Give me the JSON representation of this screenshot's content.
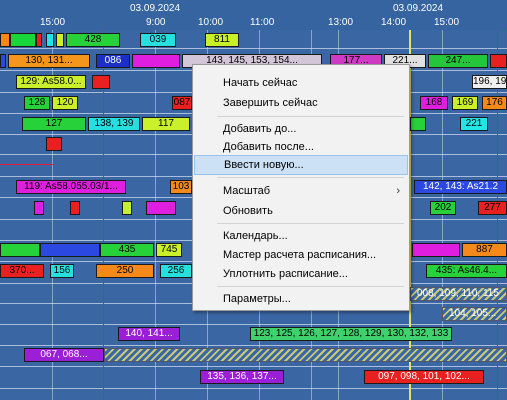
{
  "header": {
    "dates": [
      "03.09.2024",
      "03.09.2024"
    ],
    "times": [
      "15:00",
      "9:00",
      "10:00",
      "11:00",
      "13:00",
      "14:00",
      "15:00"
    ]
  },
  "bar_labels": [
    "428",
    "039",
    "811",
    "130, 131...",
    "086",
    "143, 145, 153, 154...",
    "177...",
    "221...",
    "247...",
    "129: As58.0...",
    "196, 19",
    "128",
    "120",
    "087",
    "168",
    "169",
    "176",
    "127",
    "138, 139",
    "117",
    "221",
    "119: As58.055.03/1...",
    "103",
    "142, 143: As21.2",
    "202",
    "277",
    "435",
    "745",
    "887",
    "370...",
    "156",
    "250",
    "256",
    "435: As46.4...",
    "008, 109, 110, 115",
    "104, 105...",
    "140, 141...",
    "123, 125, 126, 127, 128, 129, 130, 132, 133",
    "067, 068...",
    "135, 136, 137...",
    "097, 098, 101, 102..."
  ],
  "context_menu": {
    "items": [
      "Начать сейчас",
      "Завершить сейчас",
      "Добавить до...",
      "Добавить после...",
      "Ввести новую...",
      "Масштаб",
      "Обновить",
      "Календарь...",
      "Мастер расчета расписания...",
      "Уплотнить расписание...",
      "Параметры..."
    ],
    "highlighted_index": 4,
    "submenu_arrow": "›"
  },
  "colors": {
    "background": "#3a66a4",
    "menu_background": "#f2f2f2",
    "menu_highlight": "#cce0f6",
    "current_time_line": "#e8e35a",
    "marker_line": "#e0203a"
  }
}
